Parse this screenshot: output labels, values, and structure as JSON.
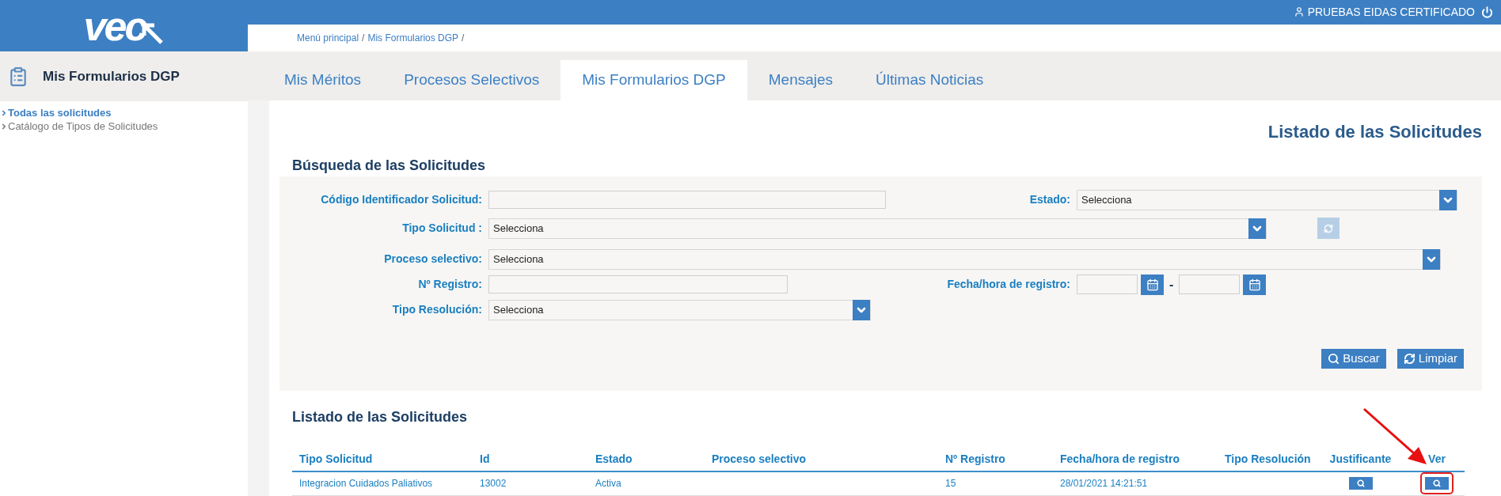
{
  "logo": {
    "text": "vec"
  },
  "user": {
    "name": "PRUEBAS EIDAS CERTIFICADO"
  },
  "breadcrumb": [
    {
      "label": "Menú principal",
      "separator": "/"
    },
    {
      "label": "Mis Formularios DGP",
      "separator": "/"
    }
  ],
  "sidebar": {
    "title": "Mis Formularios DGP",
    "items": [
      {
        "label": "Todas las solicitudes",
        "selected": true
      },
      {
        "label": "Catálogo de Tipos de Solicitudes",
        "selected": false
      }
    ]
  },
  "tabs": [
    {
      "label": "Mis Méritos",
      "selected": false
    },
    {
      "label": "Procesos Selectivos",
      "selected": false
    },
    {
      "label": "Mis Formularios DGP",
      "selected": true
    },
    {
      "label": "Mensajes",
      "selected": false
    },
    {
      "label": "Últimas Noticias",
      "selected": false
    }
  ],
  "page_title": "Listado de las Solicitudes",
  "search": {
    "title": "Búsqueda de las Solicitudes",
    "fields": [
      {
        "kind": "text",
        "label": "Código Identificador Solicitud:"
      },
      {
        "kind": "select",
        "label": "Estado:",
        "value": "Selecciona"
      },
      {
        "kind": "select",
        "label": "Tipo Solicitud :",
        "value": "Selecciona"
      },
      {
        "kind": "refresh",
        "disabled": true
      },
      {
        "kind": "select",
        "label": "Proceso selectivo:",
        "value": "Selecciona"
      },
      {
        "kind": "text",
        "label": "Nº Registro:"
      },
      {
        "kind": "date_range",
        "label": "Fecha/hora de registro:",
        "separator": "-"
      },
      {
        "kind": "select",
        "label": "Tipo Resolución:",
        "value": "Selecciona"
      }
    ],
    "buttons": [
      {
        "kind": "search",
        "label": "Buscar"
      },
      {
        "kind": "clear",
        "label": "Limpiar"
      }
    ]
  },
  "table": {
    "title": "Listado de las Solicitudes",
    "columns": [
      "Tipo Solicitud",
      "Id",
      "Estado",
      "Proceso selectivo",
      "Nº Registro",
      "Fecha/hora de registro",
      "Tipo Resolución",
      "Justificante",
      "Ver"
    ],
    "rows": [
      {
        "cells": [
          "Integracion Cuidados Paliativos",
          "13002",
          "Activa",
          "",
          "15",
          "28/01/2021 14:21:51",
          ""
        ],
        "highlight_view": true
      }
    ]
  }
}
